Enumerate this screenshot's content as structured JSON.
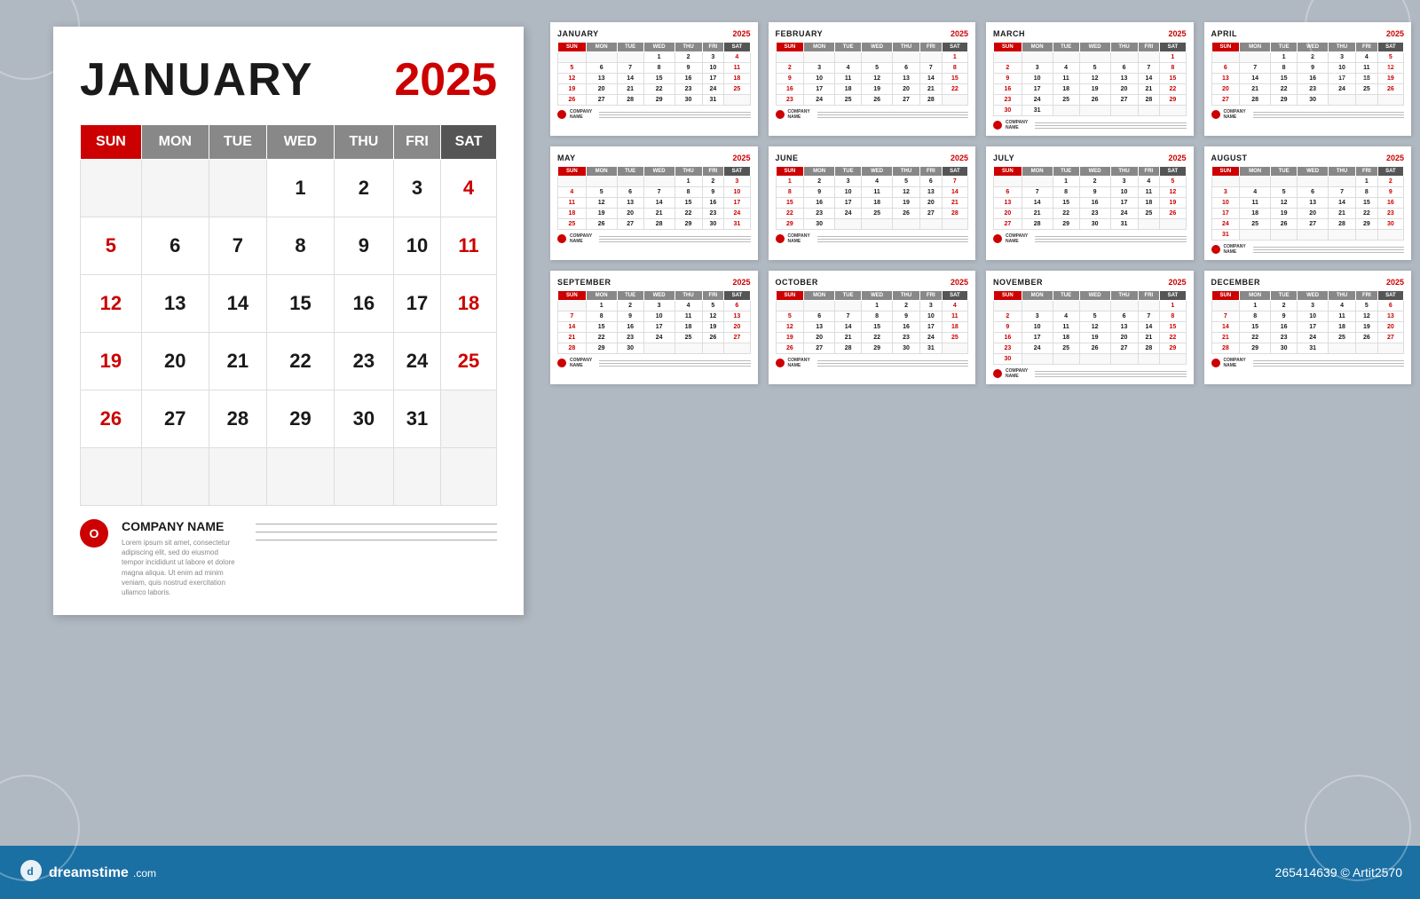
{
  "main_calendar": {
    "month": "JANUARY",
    "year": "2025",
    "days_header": [
      "SUN",
      "MON",
      "TUE",
      "WED",
      "THU",
      "FRI",
      "SAT"
    ],
    "weeks": [
      [
        "",
        "",
        "",
        "1",
        "2",
        "3",
        "4"
      ],
      [
        "5",
        "6",
        "7",
        "8",
        "9",
        "10",
        "11"
      ],
      [
        "12",
        "13",
        "14",
        "15",
        "16",
        "17",
        "18"
      ],
      [
        "19",
        "20",
        "21",
        "22",
        "23",
        "24",
        "25"
      ],
      [
        "26",
        "27",
        "28",
        "29",
        "30",
        "31",
        ""
      ],
      [
        "",
        "",
        "",
        "",
        "",
        "",
        ""
      ]
    ],
    "red_days": [
      "4",
      "11",
      "18",
      "25",
      "5",
      "12",
      "19",
      "26"
    ],
    "company_name": "COMPANY NAME",
    "company_desc": "Lorem ipsum sit amet, consectetur adipiscing elit, sed do eiusmod tempor incididunt ut labore et dolore magna aliqua. Ut enim ad minim veniam, quis nostrud exercitation ullamco laboris."
  },
  "small_calendars": [
    {
      "month": "JANUARY",
      "year": "2025",
      "weeks": [
        [
          "",
          "",
          "",
          "1",
          "2",
          "3",
          "4"
        ],
        [
          "5",
          "6",
          "7",
          "8",
          "9",
          "10",
          "11"
        ],
        [
          "12",
          "13",
          "14",
          "15",
          "16",
          "17",
          "18"
        ],
        [
          "19",
          "20",
          "21",
          "22",
          "23",
          "24",
          "25"
        ],
        [
          "26",
          "27",
          "28",
          "29",
          "30",
          "31",
          ""
        ]
      ],
      "red_cols": [
        0,
        6
      ]
    },
    {
      "month": "FEBRUARY",
      "year": "2025",
      "weeks": [
        [
          "",
          "",
          "",
          "",
          "",
          "",
          "1"
        ],
        [
          "2",
          "3",
          "4",
          "5",
          "6",
          "7",
          "8"
        ],
        [
          "9",
          "10",
          "11",
          "12",
          "13",
          "14",
          "15"
        ],
        [
          "16",
          "17",
          "18",
          "19",
          "20",
          "21",
          "22"
        ],
        [
          "23",
          "24",
          "25",
          "26",
          "27",
          "28",
          ""
        ]
      ],
      "red_cols": [
        0,
        6
      ]
    },
    {
      "month": "MARCH",
      "year": "2025",
      "weeks": [
        [
          "",
          "",
          "",
          "",
          "",
          "",
          "1"
        ],
        [
          "2",
          "3",
          "4",
          "5",
          "6",
          "7",
          "8"
        ],
        [
          "9",
          "10",
          "11",
          "12",
          "13",
          "14",
          "15"
        ],
        [
          "16",
          "17",
          "18",
          "19",
          "20",
          "21",
          "22"
        ],
        [
          "23",
          "24",
          "25",
          "26",
          "27",
          "28",
          "29"
        ],
        [
          "30",
          "31",
          "",
          "",
          "",
          "",
          ""
        ]
      ],
      "red_cols": [
        0,
        6
      ]
    },
    {
      "month": "APRIL",
      "year": "2025",
      "weeks": [
        [
          "",
          "",
          "1",
          "2",
          "3",
          "4",
          "5"
        ],
        [
          "6",
          "7",
          "8",
          "9",
          "10",
          "11",
          "12"
        ],
        [
          "13",
          "14",
          "15",
          "16",
          "17",
          "18",
          "19"
        ],
        [
          "20",
          "21",
          "22",
          "23",
          "24",
          "25",
          "26"
        ],
        [
          "27",
          "28",
          "29",
          "30",
          "",
          "",
          ""
        ]
      ],
      "red_cols": [
        0,
        6
      ]
    },
    {
      "month": "MAY",
      "year": "2025",
      "weeks": [
        [
          "",
          "",
          "",
          "",
          "1",
          "2",
          "3"
        ],
        [
          "4",
          "5",
          "6",
          "7",
          "8",
          "9",
          "10"
        ],
        [
          "11",
          "12",
          "13",
          "14",
          "15",
          "16",
          "17"
        ],
        [
          "18",
          "19",
          "20",
          "21",
          "22",
          "23",
          "24"
        ],
        [
          "25",
          "26",
          "27",
          "28",
          "29",
          "30",
          "31"
        ]
      ],
      "red_cols": [
        0,
        6
      ]
    },
    {
      "month": "JUNE",
      "year": "2025",
      "weeks": [
        [
          "1",
          "2",
          "3",
          "4",
          "5",
          "6",
          "7"
        ],
        [
          "8",
          "9",
          "10",
          "11",
          "12",
          "13",
          "14"
        ],
        [
          "15",
          "16",
          "17",
          "18",
          "19",
          "20",
          "21"
        ],
        [
          "22",
          "23",
          "24",
          "25",
          "26",
          "27",
          "28"
        ],
        [
          "29",
          "30",
          "",
          "",
          "",
          "",
          ""
        ]
      ],
      "red_cols": [
        0,
        6
      ]
    },
    {
      "month": "JULY",
      "year": "2025",
      "weeks": [
        [
          "",
          "",
          "1",
          "2",
          "3",
          "4",
          "5"
        ],
        [
          "6",
          "7",
          "8",
          "9",
          "10",
          "11",
          "12"
        ],
        [
          "13",
          "14",
          "15",
          "16",
          "17",
          "18",
          "19"
        ],
        [
          "20",
          "21",
          "22",
          "23",
          "24",
          "25",
          "26"
        ],
        [
          "27",
          "28",
          "29",
          "30",
          "31",
          "",
          ""
        ]
      ],
      "red_cols": [
        0,
        6
      ]
    },
    {
      "month": "AUGUST",
      "year": "2025",
      "weeks": [
        [
          "",
          "",
          "",
          "",
          "",
          "1",
          "2"
        ],
        [
          "3",
          "4",
          "5",
          "6",
          "7",
          "8",
          "9"
        ],
        [
          "10",
          "11",
          "12",
          "13",
          "14",
          "15",
          "16"
        ],
        [
          "17",
          "18",
          "19",
          "20",
          "21",
          "22",
          "23"
        ],
        [
          "24",
          "25",
          "26",
          "27",
          "28",
          "29",
          "30"
        ],
        [
          "31",
          "",
          "",
          "",
          "",
          "",
          ""
        ]
      ],
      "red_cols": [
        0,
        6
      ]
    },
    {
      "month": "SEPTEMBER",
      "year": "2025",
      "weeks": [
        [
          "",
          "1",
          "2",
          "3",
          "4",
          "5",
          "6"
        ],
        [
          "7",
          "8",
          "9",
          "10",
          "11",
          "12",
          "13"
        ],
        [
          "14",
          "15",
          "16",
          "17",
          "18",
          "19",
          "20"
        ],
        [
          "21",
          "22",
          "23",
          "24",
          "25",
          "26",
          "27"
        ],
        [
          "28",
          "29",
          "30",
          "",
          "",
          "",
          ""
        ]
      ],
      "red_cols": [
        0,
        6
      ]
    },
    {
      "month": "OCTOBER",
      "year": "2025",
      "weeks": [
        [
          "",
          "",
          "",
          "1",
          "2",
          "3",
          "4"
        ],
        [
          "5",
          "6",
          "7",
          "8",
          "9",
          "10",
          "11"
        ],
        [
          "12",
          "13",
          "14",
          "15",
          "16",
          "17",
          "18"
        ],
        [
          "19",
          "20",
          "21",
          "22",
          "23",
          "24",
          "25"
        ],
        [
          "26",
          "27",
          "28",
          "29",
          "30",
          "31",
          ""
        ]
      ],
      "red_cols": [
        0,
        6
      ]
    },
    {
      "month": "NOVEMBER",
      "year": "2025",
      "weeks": [
        [
          "",
          "",
          "",
          "",
          "",
          "",
          "1"
        ],
        [
          "2",
          "3",
          "4",
          "5",
          "6",
          "7",
          "8"
        ],
        [
          "9",
          "10",
          "11",
          "12",
          "13",
          "14",
          "15"
        ],
        [
          "16",
          "17",
          "18",
          "19",
          "20",
          "21",
          "22"
        ],
        [
          "23",
          "24",
          "25",
          "26",
          "27",
          "28",
          "29"
        ],
        [
          "30",
          "",
          "",
          "",
          "",
          "",
          ""
        ]
      ],
      "red_cols": [
        0,
        6
      ]
    },
    {
      "month": "DECEMBER",
      "year": "2025",
      "weeks": [
        [
          "",
          "1",
          "2",
          "3",
          "4",
          "5",
          "6"
        ],
        [
          "7",
          "8",
          "9",
          "10",
          "11",
          "12",
          "13"
        ],
        [
          "14",
          "15",
          "16",
          "17",
          "18",
          "19",
          "20"
        ],
        [
          "21",
          "22",
          "23",
          "24",
          "25",
          "26",
          "27"
        ],
        [
          "28",
          "29",
          "30",
          "31",
          "",
          "",
          ""
        ]
      ],
      "red_cols": [
        0,
        6
      ]
    }
  ],
  "dreamstime": {
    "logo": "dreamstime.com",
    "stock_id": "265414639",
    "artist": "Artit2570"
  },
  "days_short": [
    "SUN",
    "MON",
    "TUE",
    "WED",
    "THU",
    "FRI",
    "SAT"
  ],
  "company_label": "COMPANY\nNAME"
}
